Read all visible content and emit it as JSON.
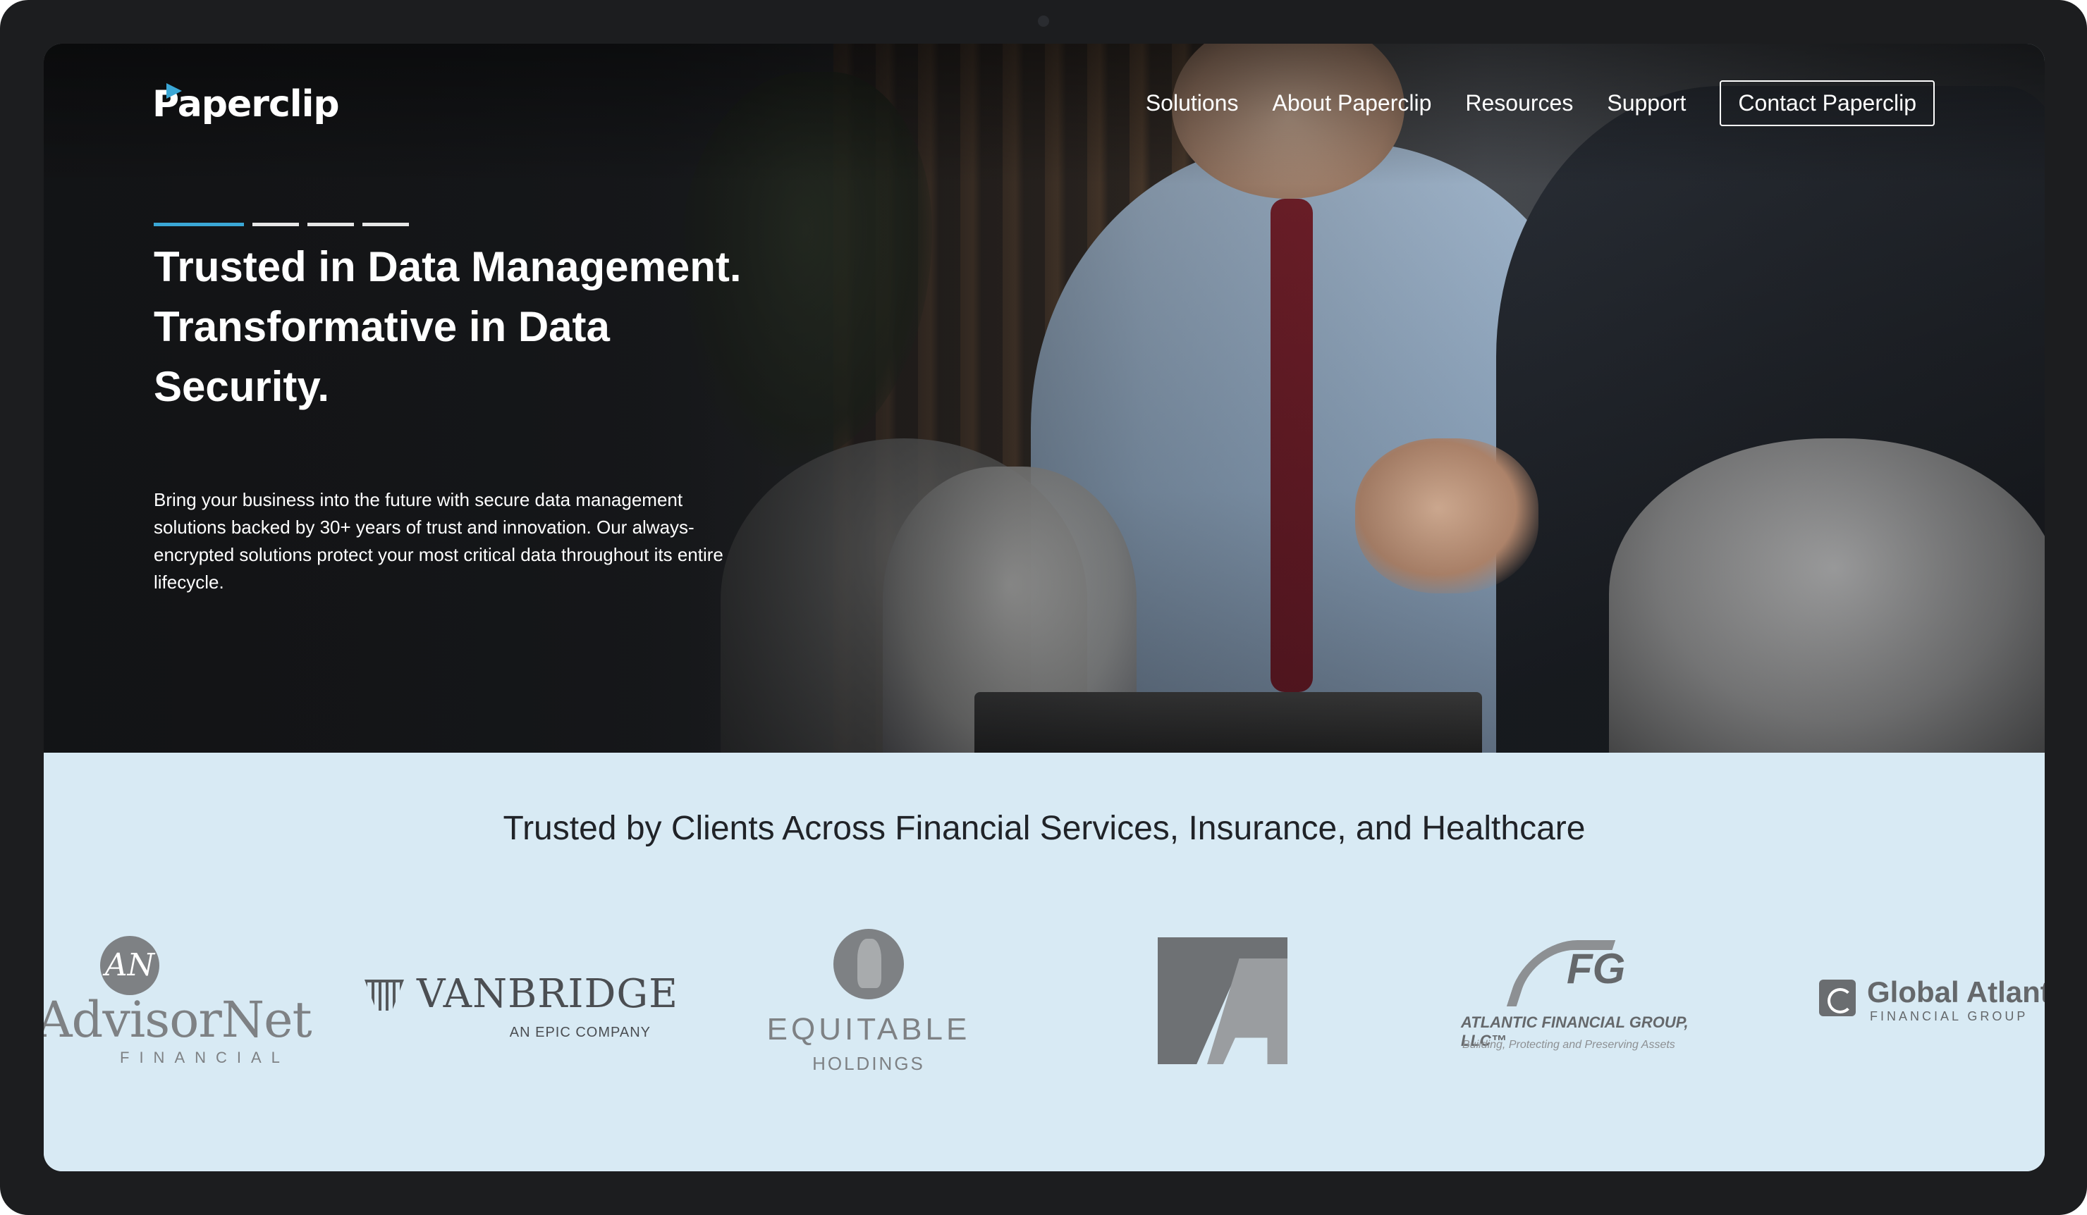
{
  "brand": {
    "name": "Paperclip",
    "accent": "#3aa7d6"
  },
  "nav": {
    "items": [
      "Solutions",
      "About Paperclip",
      "Resources",
      "Support"
    ],
    "cta": "Contact Paperclip"
  },
  "hero": {
    "slides": {
      "count": 4,
      "active_index": 0
    },
    "headline": "Trusted in Data Management. Transformative in Data Security.",
    "subtext": "Bring your business into the future with secure data management solutions backed by 30+ years of trust and innovation. Our always-encrypted solutions protect your most critical data throughout its entire lifecycle."
  },
  "clients": {
    "title": "Trusted by Clients Across Financial Services, Insurance, and Healthcare",
    "background": "#d8eaf4",
    "logos": [
      {
        "name": "AdvisorNet",
        "sub": "FINANCIAL",
        "mark": "AN"
      },
      {
        "name": "VANBRIDGE",
        "sub": "AN EPIC COMPANY"
      },
      {
        "name": "EQUITABLE",
        "sub": "HOLDINGS"
      },
      {
        "name": "FA",
        "icon": "fa-monogram-logo"
      },
      {
        "name": "ATLANTIC FINANCIAL GROUP, LLC™",
        "mark": "FG",
        "sub": "Building, Protecting and Preserving Assets"
      },
      {
        "name": "Global Atlant",
        "sub": "FINANCIAL GROUP"
      }
    ]
  }
}
